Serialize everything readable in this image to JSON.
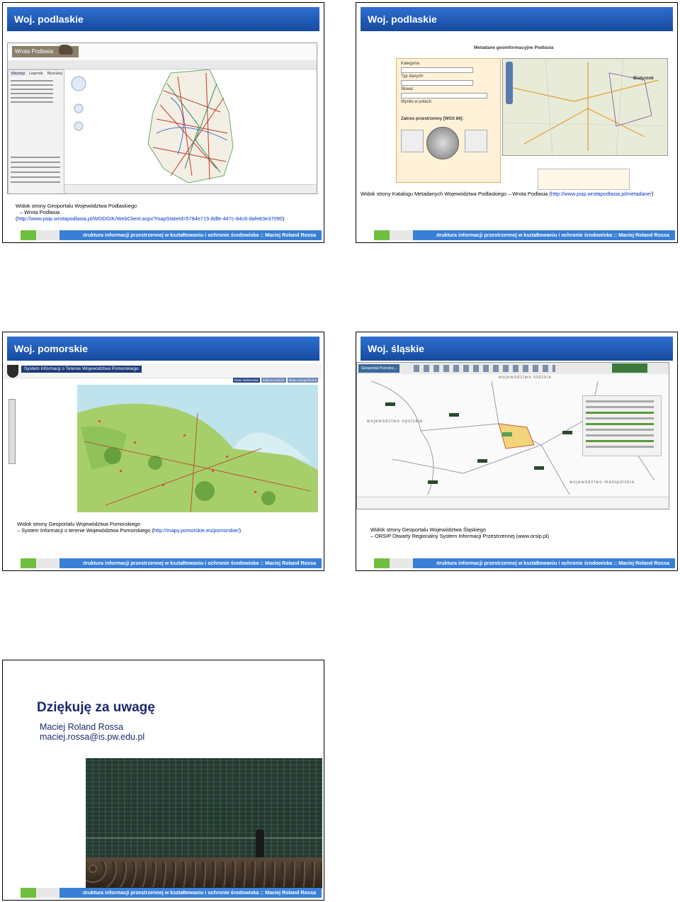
{
  "footer_text": "Infrastruktura informacji przestrzennej w kształtowaniu i ochronie środowiska :: Maciej Roland Rossa",
  "slides": [
    {
      "title": "Woj. podlaskie",
      "caption_line1": "Widok strony Geoportalu Województwa Podlaskiego",
      "caption_line2": "– Wrota Podlasia",
      "caption_line3_prefix": "(",
      "caption_link": "http://www.psip.wrotapodlasia.pl/WODGIK/WebClient.aspx?mapStateId=5784e715-8dfe-447c-84c6-dafe83e37090",
      "caption_line3_suffix": ")",
      "screenshot": {
        "logo_text": "Wrota Podlasia",
        "tabs": [
          "Warstwy",
          "Legenda",
          "Wyszukaj"
        ]
      }
    },
    {
      "title": "Woj. podlaskie",
      "caption_prefix": "Widok strony Katalogu Metadanych Województwa Podlaskiego – Wrota Podlasia (",
      "caption_link": "http://www.psip.wrotapodlasia.pl/metadane/",
      "caption_suffix": ")",
      "screenshot": {
        "heading": "Metadane geoinformacyjne Podlasia",
        "form_labels": [
          "Kategoria:",
          "Typ danych:",
          "Słowa:",
          "Wyniki w polach",
          "Zakres przestrzenny [WGS 84]:"
        ],
        "map_label": "Białystok"
      }
    },
    {
      "title": "Woj. pomorskie",
      "caption_line1": "Widok strony Geoportalu Województwa Pomorskiego",
      "caption_line2_prefix": "– System Informacji o terenie Województwa Pomorskiego (",
      "caption_link": "http://mapy.pomorskie.eu/pomorskie/",
      "caption_line2_suffix": ")",
      "screenshot": {
        "banner": "System Informacji o Terenie Województwa Pomorskiego",
        "tabs": [
          "Dane wektorowe",
          "Zdjęcia lotnicze",
          "Mapa topograficzna"
        ]
      }
    },
    {
      "title": "Woj. śląskie",
      "caption_line1": "Widok strony Geoportalu Województwa Śląskiego",
      "caption_line2": "– ORSIP Otwarty Regionalny System Informacji Przestrzennej (www.orsip.pl)",
      "screenshot": {
        "tab": "Geoportal Przestrz...",
        "labels": [
          "województwo opolskie",
          "województwo łódzkie",
          "województwo małopolskie"
        ]
      }
    },
    {
      "title_thanks": "Dziękuję za uwagę",
      "author": "Maciej Roland Rossa",
      "email": "maciej.rossa@is.pw.edu.pl"
    }
  ]
}
